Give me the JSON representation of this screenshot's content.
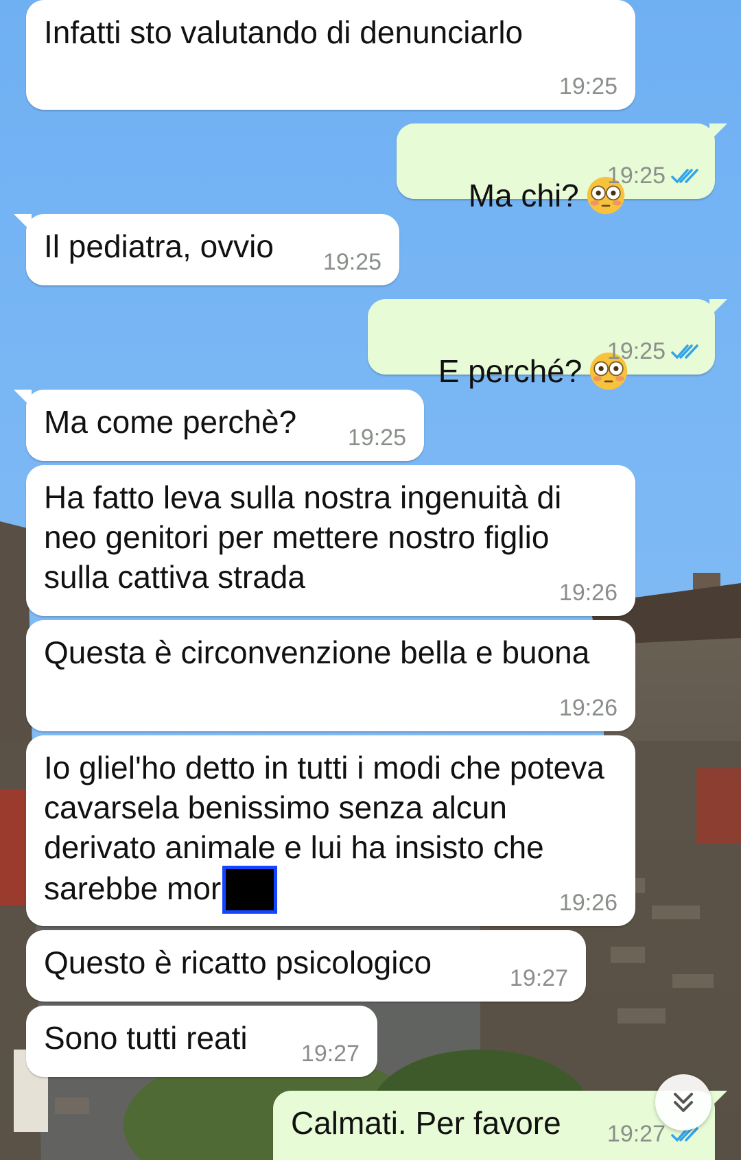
{
  "messages": [
    {
      "dir": "in",
      "text": "Infatti sto valutando di denunciarlo",
      "time": "19:25"
    },
    {
      "dir": "out",
      "text": "Ma chi?",
      "emoji": "flushed-face-emoji",
      "time": "19:25",
      "status": "read"
    },
    {
      "dir": "in",
      "text": "Il pediatra, ovvio",
      "time": "19:25"
    },
    {
      "dir": "out",
      "text": "E perché?",
      "emoji": "flushed-face-emoji",
      "time": "19:25",
      "status": "read"
    },
    {
      "dir": "in",
      "text": "Ma come perchè?",
      "time": "19:25"
    },
    {
      "dir": "in",
      "text": "Ha fatto leva sulla nostra ingenuità di neo genitori per mettere nostro figlio sulla cattiva strada",
      "time": "19:26"
    },
    {
      "dir": "in",
      "text": "Questa è circonvenzione bella e buona",
      "time": "19:26"
    },
    {
      "dir": "in",
      "text": "Io gliel'ho detto in tutti i modi che poteva cavarsela benissimo senza alcun derivato animale e lui ha insisto che sarebbe mor",
      "redacted_tail": true,
      "time": "19:26"
    },
    {
      "dir": "in",
      "text": "Questo è ricatto psicologico",
      "time": "19:27"
    },
    {
      "dir": "in",
      "text": "Sono tutti reati",
      "time": "19:27"
    },
    {
      "dir": "out",
      "text": "Calmati. Per favore",
      "time": "19:27",
      "status": "read"
    }
  ],
  "scroll_button": {
    "icon": "double-chevron-down-icon"
  },
  "colors": {
    "incoming_bubble": "#ffffff",
    "outgoing_bubble": "#e7fbd6",
    "read_ticks": "#34a3e8",
    "sky": "#7fb8f5",
    "redaction_border": "#1546ff"
  }
}
